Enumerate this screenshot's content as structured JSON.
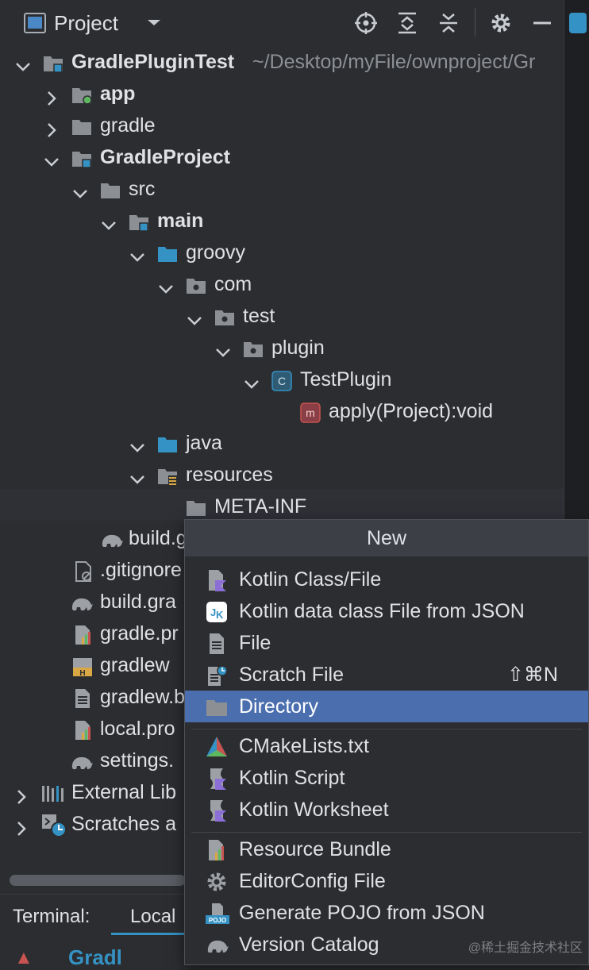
{
  "header": {
    "title": "Project"
  },
  "tree": {
    "root": {
      "name": "GradlePluginTest",
      "path": "~/Desktop/myFile/ownproject/Gr"
    },
    "app": "app",
    "gradle": "gradle",
    "gradle_project": "GradleProject",
    "src": "src",
    "main": "main",
    "groovy": "groovy",
    "com": "com",
    "test": "test",
    "plugin": "plugin",
    "test_plugin": "TestPlugin",
    "apply_method": "apply(Project):void",
    "java": "java",
    "resources": "resources",
    "meta_inf": "META-INF",
    "build_gradle_inner": "build.g",
    "gitignore": ".gitignore",
    "build_gradle": "build.gra",
    "gradle_properties": "gradle.pr",
    "gradlew": "gradlew",
    "gradlew_bat": "gradlew.b",
    "local_properties": "local.pro",
    "settings_gradle": "settings.",
    "external_libraries": "External Lib",
    "scratches": "Scratches a"
  },
  "terminal": {
    "label": "Terminal:",
    "tab": "Local",
    "cut_text": "Gradl"
  },
  "menu": {
    "title": "New",
    "items": [
      {
        "label": "Kotlin Class/File",
        "icon": "kotlin-file-icon"
      },
      {
        "label": "Kotlin data class File from JSON",
        "icon": "jk-json-icon"
      },
      {
        "label": "File",
        "icon": "file-icon"
      },
      {
        "label": "Scratch File",
        "icon": "scratch-file-icon",
        "shortcut": "⇧⌘N"
      },
      {
        "label": "Directory",
        "icon": "folder-icon",
        "selected": true
      },
      {
        "label": "CMakeLists.txt",
        "icon": "cmake-icon"
      },
      {
        "label": "Kotlin Script",
        "icon": "kotlin-script-icon"
      },
      {
        "label": "Kotlin Worksheet",
        "icon": "kotlin-worksheet-icon"
      },
      {
        "label": "Resource Bundle",
        "icon": "resource-bundle-icon"
      },
      {
        "label": "EditorConfig File",
        "icon": "gear-icon"
      },
      {
        "label": "Generate POJO from JSON",
        "icon": "pojo-icon"
      },
      {
        "label": "Version Catalog",
        "icon": "gradle-elephant-icon"
      }
    ]
  },
  "watermark": "@稀土掘金技术社区",
  "colors": {
    "accent": "#4b6eaf",
    "folder": "#8c8f94",
    "source_folder": "#3592c4"
  }
}
